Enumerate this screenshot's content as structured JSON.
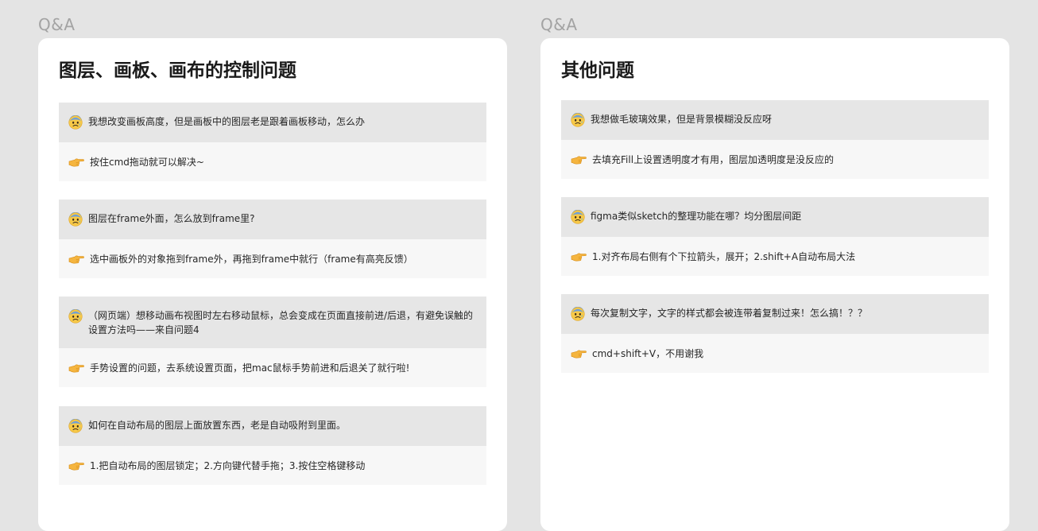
{
  "left": {
    "section_label": "Q&A",
    "title": "图层、画板、画布的控制问题",
    "items": [
      {
        "question": "我想改变画板高度，但是画板中的图层老是跟着画板移动，怎么办",
        "answer": "按住cmd拖动就可以解决~"
      },
      {
        "question": "图层在frame外面，怎么放到frame里?",
        "answer": "选中画板外的对象拖到frame外，再拖到frame中就行（frame有高亮反馈）"
      },
      {
        "question": "（网页端）想移动画布视图时左右移动鼠标，总会变成在页面直接前进/后退，有避免误触的设置方法吗——来自问题4",
        "answer": "手势设置的问题，去系统设置页面，把mac鼠标手势前进和后退关了就行啦!"
      },
      {
        "question": "如何在自动布局的图层上面放置东西，老是自动吸附到里面。",
        "answer": "1.把自动布局的图层锁定；2.方向键代替手拖；3.按住空格键移动"
      }
    ]
  },
  "right": {
    "section_label": "Q&A",
    "title": "其他问题",
    "items": [
      {
        "question": "我想做毛玻璃效果，但是背景模糊没反应呀",
        "answer": "去填充Fill上设置透明度才有用，图层加透明度是没反应的"
      },
      {
        "question": "figma类似sketch的整理功能在哪？均分图层间距",
        "answer": "1.对齐布局右侧有个下拉箭头，展开；2.shift+A自动布局大法"
      },
      {
        "question": "每次复制文字，文字的样式都会被连带着复制过来！怎么搞！？？",
        "answer": "cmd+shift+V，不用谢我"
      }
    ]
  },
  "icons": {
    "question": "anxious-face-icon",
    "answer": "pointing-hand-icon"
  },
  "colors": {
    "page_bg": "#e4e4e4",
    "card_bg": "#ffffff",
    "question_bg": "#e6e6e6",
    "answer_bg": "#f7f7f7",
    "label": "#a3a3a3"
  }
}
